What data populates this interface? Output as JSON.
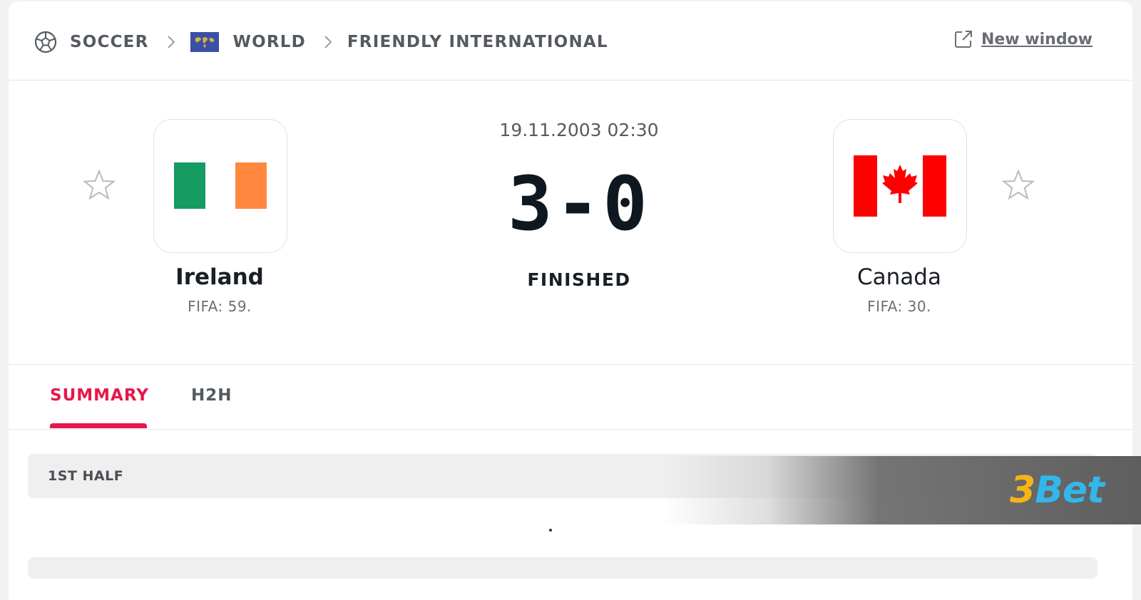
{
  "breadcrumb": {
    "sport": "SOCCER",
    "region": "WORLD",
    "competition": "FRIENDLY INTERNATIONAL",
    "sport_icon": "soccer-ball-icon",
    "separator_icon": "chevron-right-icon"
  },
  "new_window": {
    "label": "New window",
    "icon": "external-link-icon"
  },
  "match": {
    "datetime": "19.11.2003 02:30",
    "score": "3-0",
    "status": "FINISHED",
    "home": {
      "name": "Ireland",
      "rank": "FIFA: 59.",
      "flag_colors": [
        "#169b62",
        "#ffffff",
        "#ff883e"
      ]
    },
    "away": {
      "name": "Canada",
      "rank": "FIFA: 30.",
      "flag_colors": [
        "#ff0000",
        "#ffffff",
        "#ff0000"
      ]
    },
    "favorite_icon": "star-outline-icon"
  },
  "tabs": [
    {
      "label": "SUMMARY",
      "active": true
    },
    {
      "label": "H2H",
      "active": false
    }
  ],
  "summary": {
    "section_label": "1ST HALF",
    "placeholder": "."
  },
  "watermark": {
    "prefix": "3",
    "suffix": "Bet"
  },
  "colors": {
    "accent": "#e6174b",
    "text_dark": "#1a1f26",
    "text_muted": "#555a60"
  }
}
